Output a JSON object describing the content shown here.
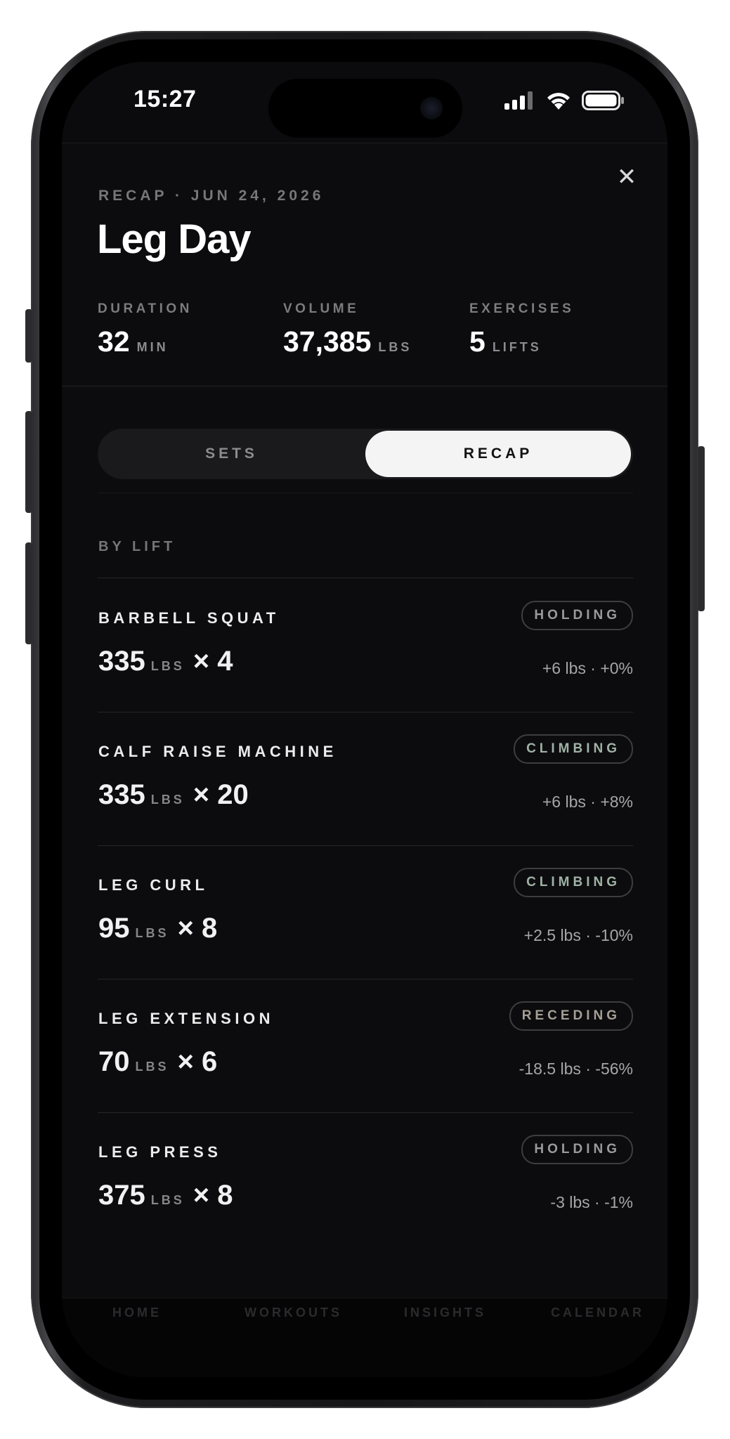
{
  "status_bar": {
    "time": "15:27"
  },
  "header": {
    "eyebrow": "RECAP · JUN 24, 2026",
    "title": "Leg Day",
    "close_glyph": "✕",
    "stats": [
      {
        "label": "DURATION",
        "value": "32",
        "unit": "MIN"
      },
      {
        "label": "VOLUME",
        "value": "37,385",
        "unit": "LBS"
      },
      {
        "label": "EXERCISES",
        "value": "5",
        "unit": "LIFTS"
      }
    ]
  },
  "segment": {
    "options": [
      "SETS",
      "RECAP"
    ],
    "selected": "RECAP"
  },
  "section": {
    "label": "BY LIFT"
  },
  "lifts": [
    {
      "name": "BARBELL SQUAT",
      "status": "HOLDING",
      "weight": "335",
      "unit": "LBS",
      "reps": "× 4",
      "delta": "+6 lbs · +0%"
    },
    {
      "name": "CALF RAISE MACHINE",
      "status": "CLIMBING",
      "weight": "335",
      "unit": "LBS",
      "reps": "× 20",
      "delta": "+6 lbs · +8%"
    },
    {
      "name": "LEG CURL",
      "status": "CLIMBING",
      "weight": "95",
      "unit": "LBS",
      "reps": "× 8",
      "delta": "+2.5 lbs · -10%"
    },
    {
      "name": "LEG EXTENSION",
      "status": "RECEDING",
      "weight": "70",
      "unit": "LBS",
      "reps": "× 6",
      "delta": "-18.5 lbs · -56%"
    },
    {
      "name": "LEG PRESS",
      "status": "HOLDING",
      "weight": "375",
      "unit": "LBS",
      "reps": "× 8",
      "delta": "-3 lbs · -1%"
    }
  ],
  "status_colors": {
    "HOLDING": "#9a9a9f",
    "CLIMBING": "#9fb2a6",
    "RECEDING": "#a59f96"
  },
  "tab_bar": {
    "tabs": [
      "HOME",
      "WORKOUTS",
      "INSIGHTS",
      "CALENDAR"
    ]
  }
}
